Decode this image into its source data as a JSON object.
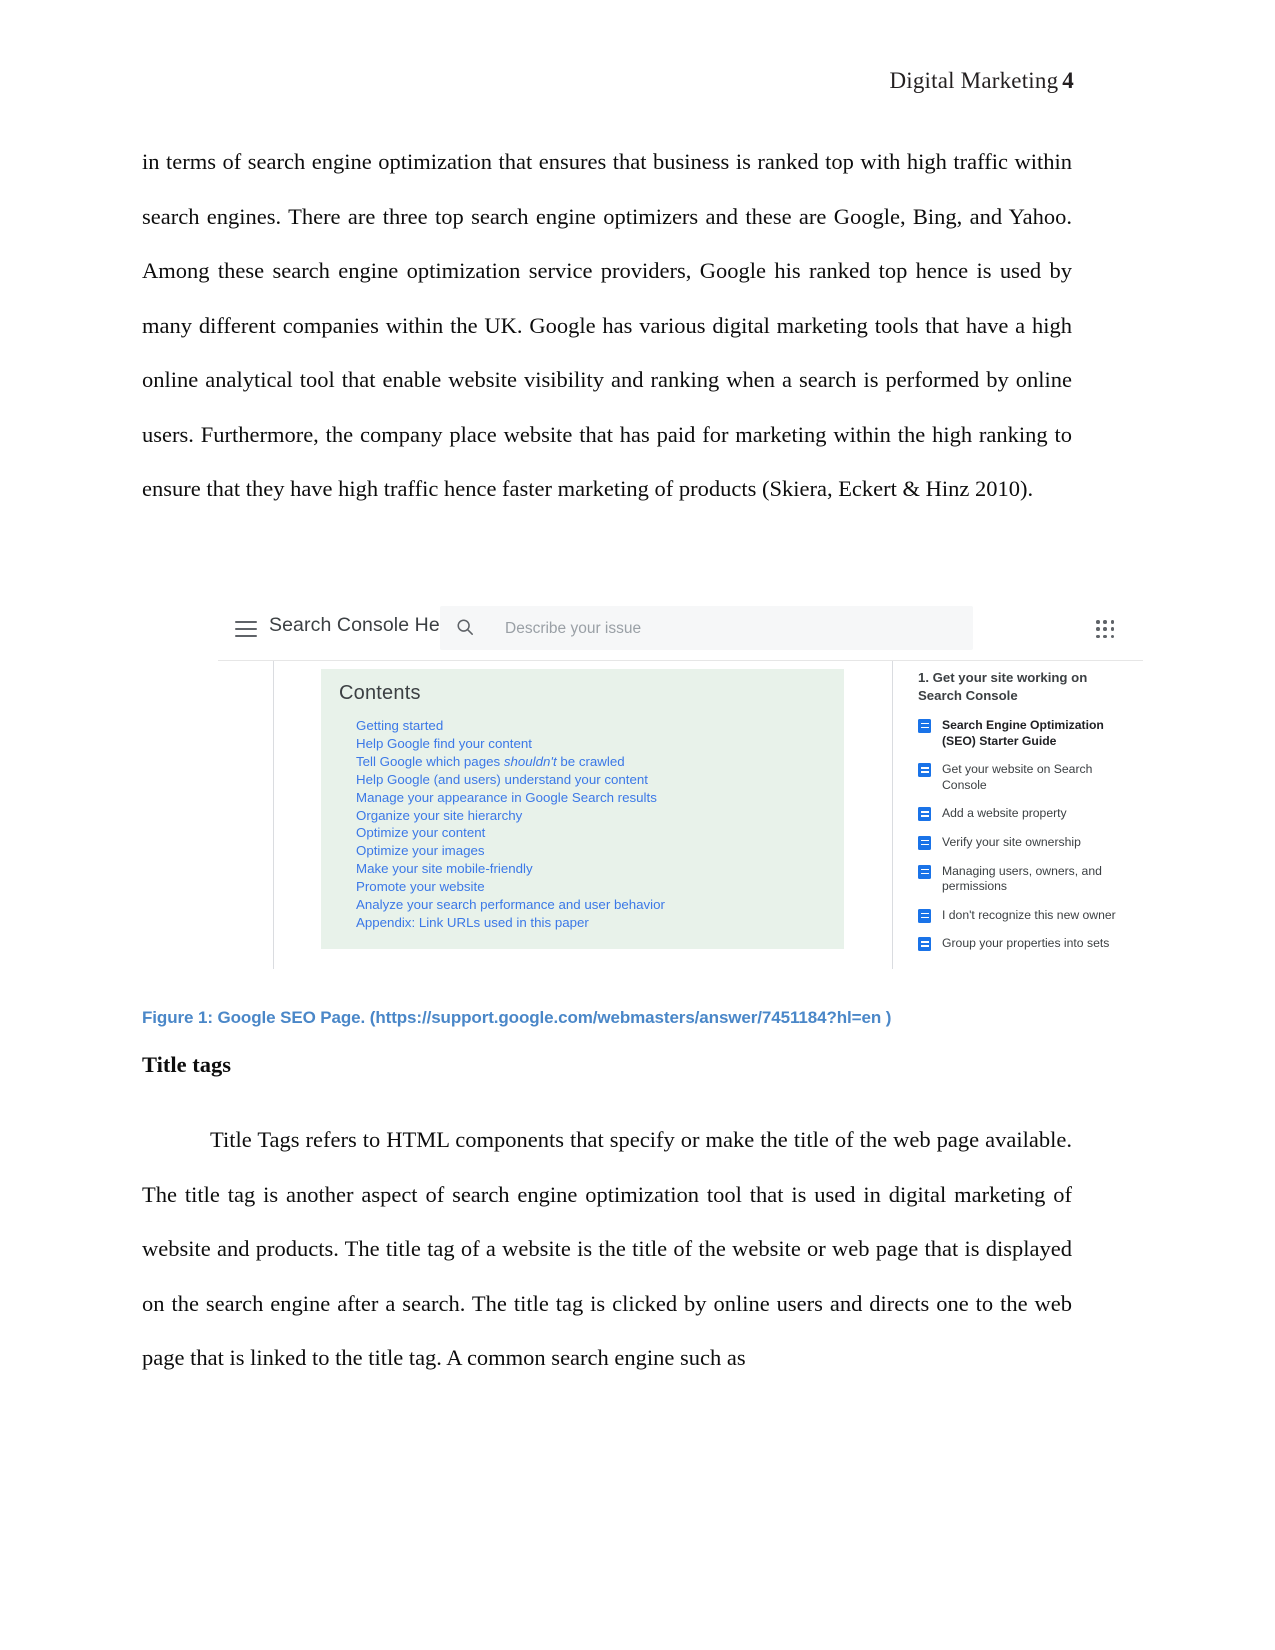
{
  "header": {
    "title": "Digital Marketing",
    "page_number": "4"
  },
  "paragraphs": {
    "p1": "in terms of search engine optimization that ensures that business is ranked top with high traffic within search engines. There are three top search engine optimizers and these are Google, Bing, and Yahoo. Among these search engine optimization service providers, Google his ranked top hence is used by many different companies within the UK. Google has various digital marketing tools that have a high online analytical tool that enable website visibility and ranking when a search is performed by online users. Furthermore, the company place website that has paid for marketing within the high ranking to ensure that they have high traffic hence faster marketing of products (Skiera, Eckert & Hinz 2010).",
    "p2": "Title Tags refers to HTML components that specify or make the title of the web page available. The title tag is another aspect of search engine optimization tool that is used in digital marketing of website and products. The title tag of a website is the title of the website or web page that is displayed on the search engine after a search.  The title tag is clicked by online users and directs one to the web page that is linked to the title tag. A common search engine such as"
  },
  "figure": {
    "topbar": {
      "menu_icon": "hamburger-menu-icon",
      "product_title": "Search Console Help",
      "search_icon": "search-icon",
      "search_placeholder": "Describe your issue",
      "apps_icon": "apps-grid-icon"
    },
    "contents": {
      "title": "Contents",
      "background_color": "#e8f2ea",
      "items": [
        {
          "text": "Getting started"
        },
        {
          "text": "Help Google find your content"
        },
        {
          "pre": "Tell Google which pages ",
          "italic": "shouldn't",
          "post": " be crawled"
        },
        {
          "text": "Help Google (and users) understand your content"
        },
        {
          "text": "Manage your appearance in Google Search results"
        },
        {
          "text": "Organize your site hierarchy"
        },
        {
          "text": "Optimize your content"
        },
        {
          "text": "Optimize your images"
        },
        {
          "text": "Make your site mobile-friendly"
        },
        {
          "text": "Promote your website"
        },
        {
          "text": "Analyze your search performance and user behavior"
        },
        {
          "text": "Appendix: Link URLs used in this paper"
        }
      ]
    },
    "right_panel": {
      "heading": "1. Get your site working on Search Console",
      "items": [
        {
          "label": "Search Engine Optimization (SEO) Starter Guide",
          "current": true
        },
        {
          "label": "Get your website on Search Console",
          "current": false
        },
        {
          "label": "Add a website property",
          "current": false
        },
        {
          "label": "Verify your site ownership",
          "current": false
        },
        {
          "label": "Managing users, owners, and permissions",
          "current": false
        },
        {
          "label": "I don't recognize this new owner",
          "current": false
        },
        {
          "label": "Group your properties into sets",
          "current": false
        }
      ]
    },
    "caption": "Figure 1: Google SEO Page. (https://support.google.com/webmasters/answer/7451184?hl=en )",
    "caption_color": "#4a87c8"
  },
  "section": {
    "title_tags_heading": "Title tags"
  }
}
